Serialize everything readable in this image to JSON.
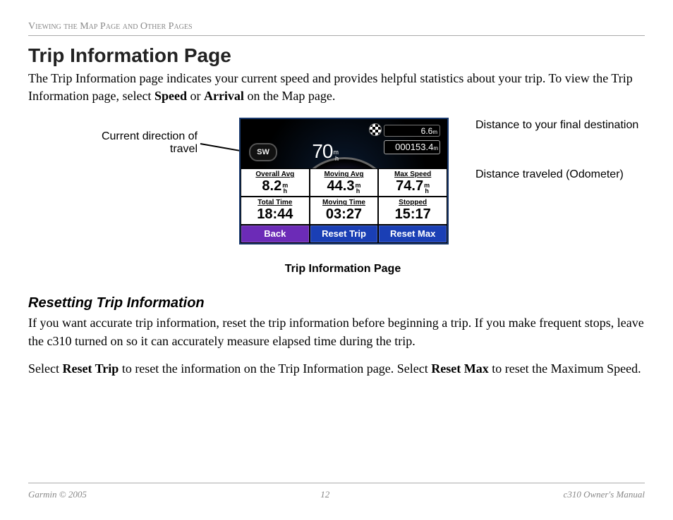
{
  "breadcrumb": "Viewing the Map Page and Other Pages",
  "title": "Trip Information Page",
  "para1_pre": "The Trip Information page indicates your current speed and provides helpful statistics about your trip. To view the Trip Information page, select ",
  "para1_b1": "Speed",
  "para1_mid": " or ",
  "para1_b2": "Arrival",
  "para1_post": " on the Map page.",
  "callouts": {
    "direction": "Current direction of travel",
    "dest_dist": "Distance to your final destination",
    "odometer": "Distance traveled (Odometer)"
  },
  "gps": {
    "compass": "SW",
    "speed_value": "70",
    "speed_unit_top": "m",
    "speed_unit_bot": "h",
    "dest_distance": "6.6",
    "dest_unit": "m",
    "odometer": "000153.4",
    "odo_unit": "m",
    "stats": [
      {
        "label": "Overall Avg",
        "value": "8.2",
        "unit_t": "m",
        "unit_b": "h"
      },
      {
        "label": "Moving Avg",
        "value": "44.3",
        "unit_t": "m",
        "unit_b": "h"
      },
      {
        "label": "Max Speed",
        "value": "74.7",
        "unit_t": "m",
        "unit_b": "h"
      },
      {
        "label": "Total Time",
        "value": "18:44",
        "unit_t": "",
        "unit_b": ""
      },
      {
        "label": "Moving Time",
        "value": "03:27",
        "unit_t": "",
        "unit_b": ""
      },
      {
        "label": "Stopped",
        "value": "15:17",
        "unit_t": "",
        "unit_b": ""
      }
    ],
    "buttons": {
      "back": "Back",
      "reset_trip": "Reset Trip",
      "reset_max": "Reset Max"
    }
  },
  "figure_caption": "Trip Information Page",
  "subhead": "Resetting Trip Information",
  "para2": "If you want accurate trip information, reset the trip information before beginning a trip. If you make frequent stops, leave the c310 turned on so it can accurately measure elapsed time during the trip.",
  "para3_a": "Select ",
  "para3_b1": "Reset Trip",
  "para3_b": " to reset the information on the Trip Information page. Select ",
  "para3_b2": "Reset Max",
  "para3_c": " to reset the Maximum Speed.",
  "footer": {
    "left": "Garmin © 2005",
    "center": "12",
    "right": "c310 Owner's Manual"
  }
}
